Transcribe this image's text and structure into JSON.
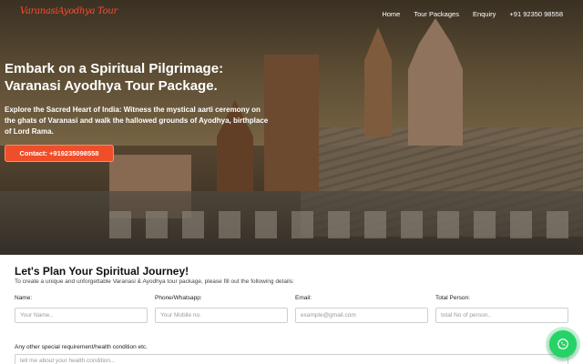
{
  "logo": {
    "text": "VaranasiAyodhya Tour"
  },
  "nav": {
    "items": [
      "Home",
      "Tour Packages",
      "Enquiry",
      "+91 92350 98558"
    ]
  },
  "hero": {
    "title": "Embark on a Spiritual Pilgrimage: Varanasi Ayodhya Tour Package.",
    "description": "Explore the Sacred Heart of India: Witness the mystical aarti ceremony on the ghats of Varanasi and walk the hallowed grounds of Ayodhya, birthplace of Lord Rama.",
    "cta_label": "Contact: +919235098558"
  },
  "form": {
    "title": "Let's Plan Your Spiritual Journey!",
    "subtitle": "To create a unique and unforgettable Varanasi & Ayodhya tour package, please fill out the following details:",
    "fields": [
      {
        "label": "Name:",
        "placeholder": "Your Name.."
      },
      {
        "label": "Phone/Whatsapp:",
        "placeholder": "Your Mobile no."
      },
      {
        "label": "Email:",
        "placeholder": "example@gmail.com"
      },
      {
        "label": "Total Person:",
        "placeholder": "total No of person.."
      }
    ],
    "requirement_label": "Any other special requirement/health condition etc.",
    "requirement_placeholder": "tell me about your health condition..."
  },
  "colors": {
    "accent": "#f04e2a",
    "logo": "#ff3b1d",
    "whatsapp": "#25d366"
  },
  "icons": {
    "whatsapp": "whatsapp-icon"
  }
}
